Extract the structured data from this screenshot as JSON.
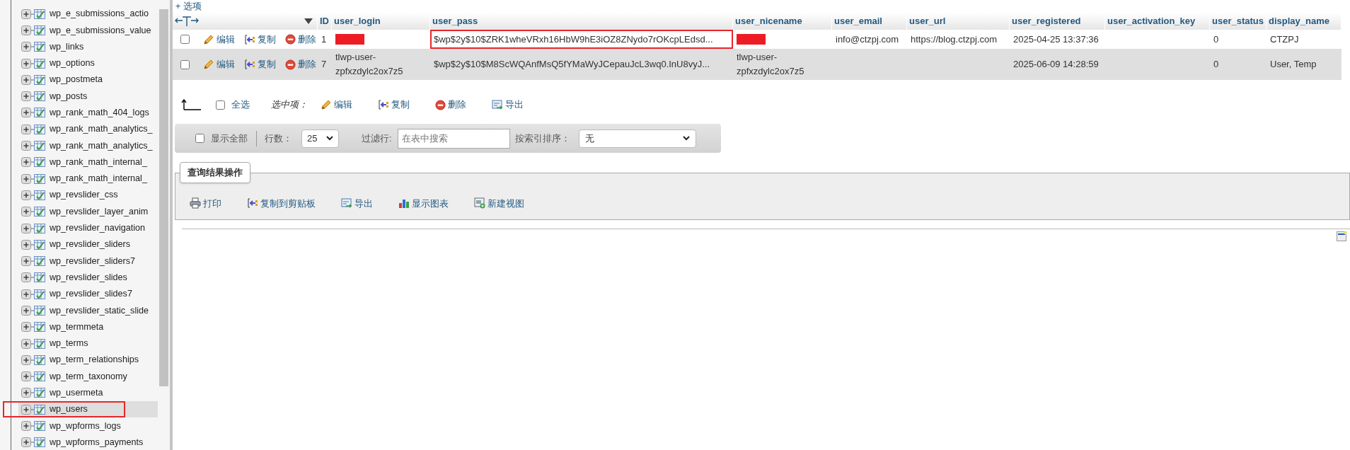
{
  "sidebar": {
    "items": [
      {
        "label": "wp_e_submissions_actio",
        "selected": false,
        "outlined": false
      },
      {
        "label": "wp_e_submissions_value",
        "selected": false,
        "outlined": false
      },
      {
        "label": "wp_links",
        "selected": false,
        "outlined": false
      },
      {
        "label": "wp_options",
        "selected": false,
        "outlined": false
      },
      {
        "label": "wp_postmeta",
        "selected": false,
        "outlined": false
      },
      {
        "label": "wp_posts",
        "selected": false,
        "outlined": false
      },
      {
        "label": "wp_rank_math_404_logs",
        "selected": false,
        "outlined": false
      },
      {
        "label": "wp_rank_math_analytics_",
        "selected": false,
        "outlined": false
      },
      {
        "label": "wp_rank_math_analytics_",
        "selected": false,
        "outlined": false
      },
      {
        "label": "wp_rank_math_internal_",
        "selected": false,
        "outlined": false
      },
      {
        "label": "wp_rank_math_internal_",
        "selected": false,
        "outlined": false
      },
      {
        "label": "wp_revslider_css",
        "selected": false,
        "outlined": false
      },
      {
        "label": "wp_revslider_layer_anim",
        "selected": false,
        "outlined": false
      },
      {
        "label": "wp_revslider_navigation",
        "selected": false,
        "outlined": false
      },
      {
        "label": "wp_revslider_sliders",
        "selected": false,
        "outlined": false
      },
      {
        "label": "wp_revslider_sliders7",
        "selected": false,
        "outlined": false
      },
      {
        "label": "wp_revslider_slides",
        "selected": false,
        "outlined": false
      },
      {
        "label": "wp_revslider_slides7",
        "selected": false,
        "outlined": false
      },
      {
        "label": "wp_revslider_static_slide",
        "selected": false,
        "outlined": false
      },
      {
        "label": "wp_termmeta",
        "selected": false,
        "outlined": false
      },
      {
        "label": "wp_terms",
        "selected": false,
        "outlined": false
      },
      {
        "label": "wp_term_relationships",
        "selected": false,
        "outlined": false
      },
      {
        "label": "wp_term_taxonomy",
        "selected": false,
        "outlined": false
      },
      {
        "label": "wp_usermeta",
        "selected": false,
        "outlined": false
      },
      {
        "label": "wp_users",
        "selected": true,
        "outlined": true
      },
      {
        "label": "wp_wpforms_logs",
        "selected": false,
        "outlined": false
      },
      {
        "label": "wp_wpforms_payments",
        "selected": false,
        "outlined": false
      }
    ]
  },
  "options_link": "+ 选项",
  "table": {
    "columns": [
      "ID",
      "user_login",
      "user_pass",
      "user_nicename",
      "user_email",
      "user_url",
      "user_registered",
      "user_activation_key",
      "user_status",
      "display_name"
    ],
    "rows": [
      {
        "checked": false,
        "actions": [
          {
            "kind": "edit",
            "label": "编辑"
          },
          {
            "kind": "copy",
            "label": "复制"
          },
          {
            "kind": "delete",
            "label": "删除"
          }
        ],
        "cells": [
          {
            "kind": "text",
            "text": "1"
          },
          {
            "kind": "redacted"
          },
          {
            "kind": "text",
            "text": "$wp$2y$10$ZRK1wheVRxh16HbW9hE3iOZ8ZNydo7rOKcpLEdsd...",
            "outlined": true
          },
          {
            "kind": "redacted"
          },
          {
            "kind": "text",
            "text": "info@ctzpj.com"
          },
          {
            "kind": "text",
            "text": "https://blog.ctzpj.com"
          },
          {
            "kind": "text",
            "text": "2025-04-25 13:37:36"
          },
          {
            "kind": "empty"
          },
          {
            "kind": "text",
            "text": "0"
          },
          {
            "kind": "text",
            "text": "CTZPJ"
          }
        ]
      },
      {
        "checked": false,
        "actions": [
          {
            "kind": "edit",
            "label": "编辑"
          },
          {
            "kind": "copy",
            "label": "复制"
          },
          {
            "kind": "delete",
            "label": "删除"
          }
        ],
        "cells": [
          {
            "kind": "text",
            "text": "7"
          },
          {
            "kind": "text",
            "text": "tlwp-user-zpfxzdylc2ox7z5"
          },
          {
            "kind": "text",
            "text": "$wp$2y$10$M8ScWQAnfMsQ5fYMaWyJCepauJcL3wq0.InU8vyJ..."
          },
          {
            "kind": "text",
            "text": "tlwp-user-zpfxzdylc2ox7z5"
          },
          {
            "kind": "empty"
          },
          {
            "kind": "empty"
          },
          {
            "kind": "text",
            "text": "2025-06-09 14:28:59"
          },
          {
            "kind": "empty"
          },
          {
            "kind": "text",
            "text": "0"
          },
          {
            "kind": "text",
            "text": "User, Temp"
          }
        ]
      }
    ]
  },
  "bulk_actions": {
    "select_all": {
      "label": "全选",
      "checked": false
    },
    "with_selected": "选中项：",
    "actions": [
      {
        "kind": "edit",
        "label": "编辑"
      },
      {
        "kind": "copy",
        "label": "复制"
      },
      {
        "kind": "delete",
        "label": "删除"
      },
      {
        "kind": "export",
        "label": "导出"
      }
    ]
  },
  "filter_bar": {
    "show_all": {
      "label": "显示全部",
      "checked": false
    },
    "rows_label": "行数：",
    "rows_value": "25",
    "filter_label": "过滤行:",
    "filter_placeholder": "在表中搜索",
    "sort_label": "按索引排序：",
    "sort_value": "无"
  },
  "query_results": {
    "title": "查询结果操作",
    "actions": [
      {
        "kind": "print",
        "label": "打印"
      },
      {
        "kind": "copy",
        "label": "复制到剪贴板"
      },
      {
        "kind": "export",
        "label": "导出"
      },
      {
        "kind": "chart",
        "label": "显示图表"
      },
      {
        "kind": "view",
        "label": "新建视图"
      }
    ]
  }
}
